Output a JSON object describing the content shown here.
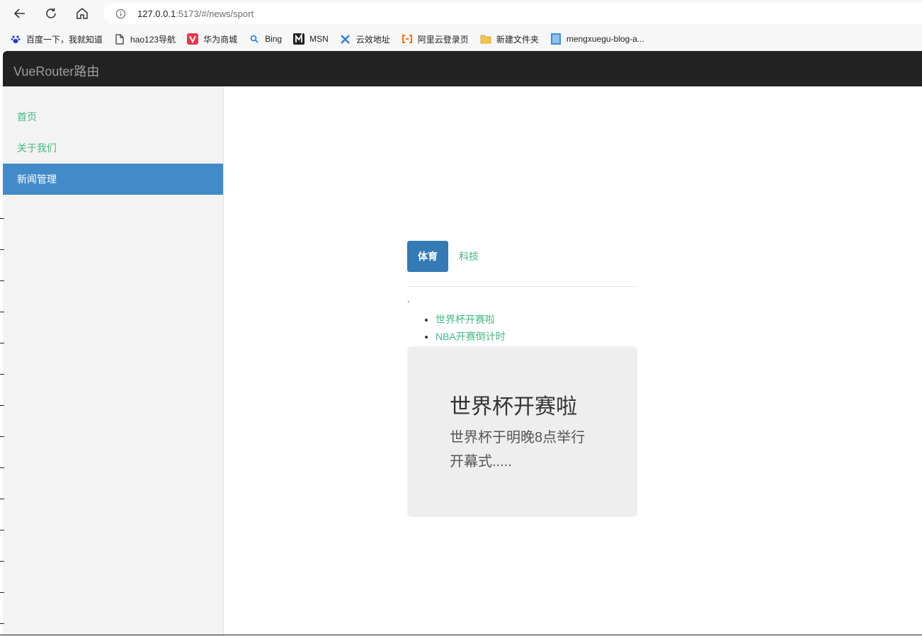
{
  "browser": {
    "url_host": "127.0.0.1",
    "url_rest": ":5173/#/news/sport",
    "bookmarks": [
      {
        "label": "百度一下，我就知道",
        "icon": "baidu-icon"
      },
      {
        "label": "hao123导航",
        "icon": "page-icon"
      },
      {
        "label": "华为商城",
        "icon": "vmall-icon"
      },
      {
        "label": "Bing",
        "icon": "bing-search-icon"
      },
      {
        "label": "MSN",
        "icon": "msn-icon"
      },
      {
        "label": "云效地址",
        "icon": "yunxiao-icon"
      },
      {
        "label": "阿里云登录页",
        "icon": "aliyun-icon"
      },
      {
        "label": "新建文件夹",
        "icon": "folder-icon"
      },
      {
        "label": "mengxuegu-blog-a...",
        "icon": "blue-page-icon"
      }
    ]
  },
  "app": {
    "brand": "VueRouter路由",
    "sidebar": {
      "items": [
        {
          "label": "首页",
          "active": false
        },
        {
          "label": "关于我们",
          "active": false
        },
        {
          "label": "新闻管理",
          "active": true
        }
      ]
    },
    "tabs": [
      {
        "label": "体育",
        "active": true
      },
      {
        "label": "科技",
        "active": false
      }
    ],
    "tick_mark": "`",
    "news_items": [
      "世界杯开赛啦",
      "NBA开赛倒计时"
    ],
    "detail": {
      "title": "世界杯开赛啦",
      "body_line1": "世界杯于明晚8点举行",
      "body_line2": "开幕式....."
    }
  },
  "colors": {
    "link_green": "#42b983",
    "active_blue_sidebar": "#428bca",
    "active_blue_tab": "#337ab7",
    "header_dark": "#222222"
  }
}
